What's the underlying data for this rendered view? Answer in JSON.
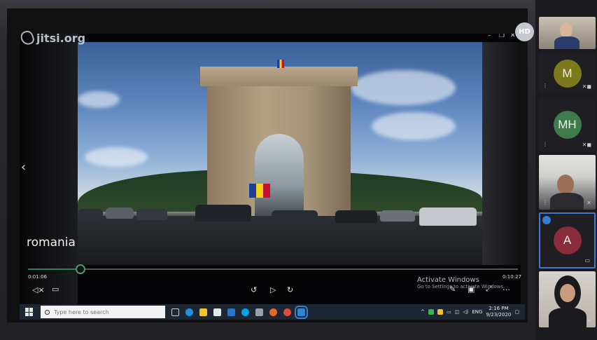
{
  "app": {
    "logo_text": "jitsi.org",
    "quality_badge": "HD"
  },
  "video": {
    "caption": "romania",
    "current_time": "0:01:06",
    "total_time": "0:10:27",
    "progress": 0.105,
    "window_controls": [
      "–",
      "❐",
      "✕"
    ]
  },
  "watermark": {
    "line1": "Activate Windows",
    "line2": "Go to Settings to activate Windows."
  },
  "taskbar": {
    "search_placeholder": "Type here to search",
    "language": "ENG",
    "time": "2:16 PM",
    "date": "9/23/2020"
  },
  "participants": [
    {
      "type": "video",
      "label": ""
    },
    {
      "type": "avatar",
      "initials": "M",
      "color": "#7c7a1c"
    },
    {
      "type": "avatar",
      "initials": "MH",
      "color": "#3f7a4a"
    },
    {
      "type": "video",
      "label": ""
    },
    {
      "type": "avatar",
      "initials": "A",
      "color": "#8a2c3a",
      "active": true
    },
    {
      "type": "video",
      "label": ""
    }
  ],
  "colors": {
    "progress": "#2c7f58",
    "taskbar": "#1d2733",
    "active_border": "#3b7bd0"
  }
}
